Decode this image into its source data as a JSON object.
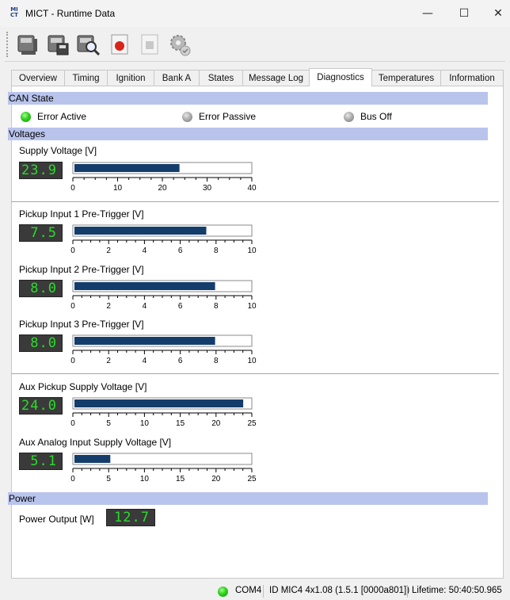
{
  "window": {
    "logo_text": "MI CT",
    "title": "MICT - Runtime Data",
    "minimize": "—",
    "maximize": "☐",
    "close": "✕"
  },
  "toolbar": {
    "items": [
      {
        "name": "device-icon"
      },
      {
        "name": "save-icon"
      },
      {
        "name": "search-device-icon"
      },
      {
        "name": "record-icon"
      },
      {
        "name": "stop-icon"
      },
      {
        "name": "settings-gear-icon"
      }
    ]
  },
  "tabs": [
    "Overview",
    "Timing",
    "Ignition",
    "Bank A",
    "States",
    "Message Log",
    "Diagnostics",
    "Temperatures",
    "Information"
  ],
  "active_tab": "Diagnostics",
  "can_state": {
    "heading": "CAN State",
    "error_active": "Error Active",
    "error_passive": "Error Passive",
    "bus_off": "Bus Off"
  },
  "voltages": {
    "heading": "Voltages",
    "supply": {
      "label": "Supply Voltage [V]",
      "display": "23.9",
      "value": 23.9,
      "max": 40,
      "ticks": [
        "0",
        "10",
        "20",
        "30",
        "40"
      ]
    },
    "pickup1": {
      "label": "Pickup Input 1 Pre-Trigger [V]",
      "display": "7.5",
      "value": 7.5,
      "max": 10,
      "ticks": [
        "0",
        "2",
        "4",
        "6",
        "8",
        "10"
      ]
    },
    "pickup2": {
      "label": "Pickup Input 2 Pre-Trigger [V]",
      "display": "8.0",
      "value": 8.0,
      "max": 10,
      "ticks": [
        "0",
        "2",
        "4",
        "6",
        "8",
        "10"
      ]
    },
    "pickup3": {
      "label": "Pickup Input 3 Pre-Trigger [V]",
      "display": "8.0",
      "value": 8.0,
      "max": 10,
      "ticks": [
        "0",
        "2",
        "4",
        "6",
        "8",
        "10"
      ]
    },
    "aux_pickup": {
      "label": "Aux Pickup Supply Voltage [V]",
      "display": "24.0",
      "value": 24.0,
      "max": 25,
      "ticks": [
        "0",
        "5",
        "10",
        "15",
        "20",
        "25"
      ]
    },
    "aux_analog": {
      "label": "Aux Analog Input Supply Voltage [V]",
      "display": "5.1",
      "value": 5.1,
      "max": 25,
      "ticks": [
        "0",
        "5",
        "10",
        "15",
        "20",
        "25"
      ]
    }
  },
  "power": {
    "heading": "Power",
    "label": "Power Output [W]",
    "display": "12.7"
  },
  "status": {
    "port": "COM4",
    "device": "ID MIC4 4x1.08 (1.5.1 [0000a801])",
    "lifetime": "Lifetime: 50:40:50.965"
  },
  "colors": {
    "section_band": "#b9c4ed",
    "bar_fill": "#143d6b",
    "lcd_bg": "#3a3a3a",
    "lcd_text": "#2bdc2b",
    "led_green": "#2fcf1c",
    "led_gray": "#a8a8a8"
  }
}
